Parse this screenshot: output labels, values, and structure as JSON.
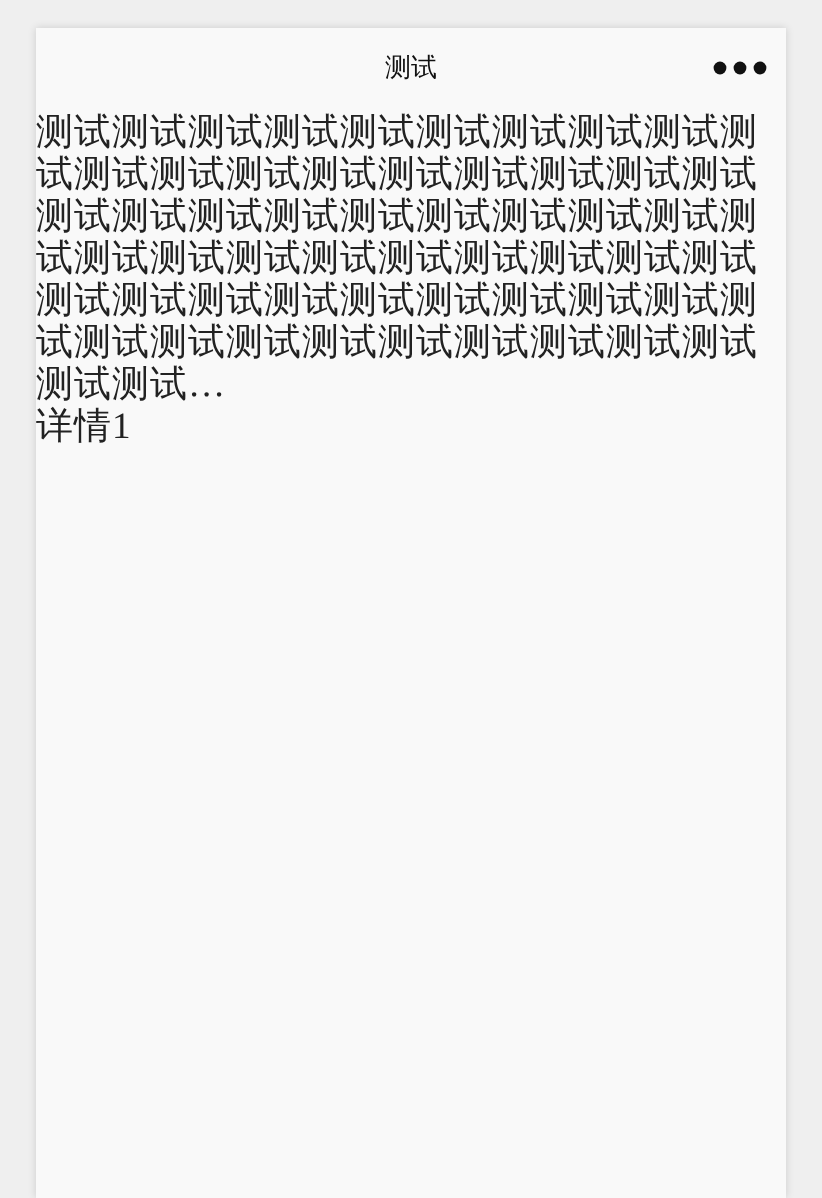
{
  "header": {
    "title": "测试"
  },
  "content": {
    "paragraph": "测试测试测试测试测试测试测试测试测试测试测试测试测试测试测试测试测试测试测试测试测试测试测试测试测试测试测试测试测试测试测试测试测试测试测试测试测试测试测试测试测试测试测试测试测试测试测试测试测试测试测试测试测试测试测试测试测试测试测试…",
    "detail": "详情1"
  }
}
